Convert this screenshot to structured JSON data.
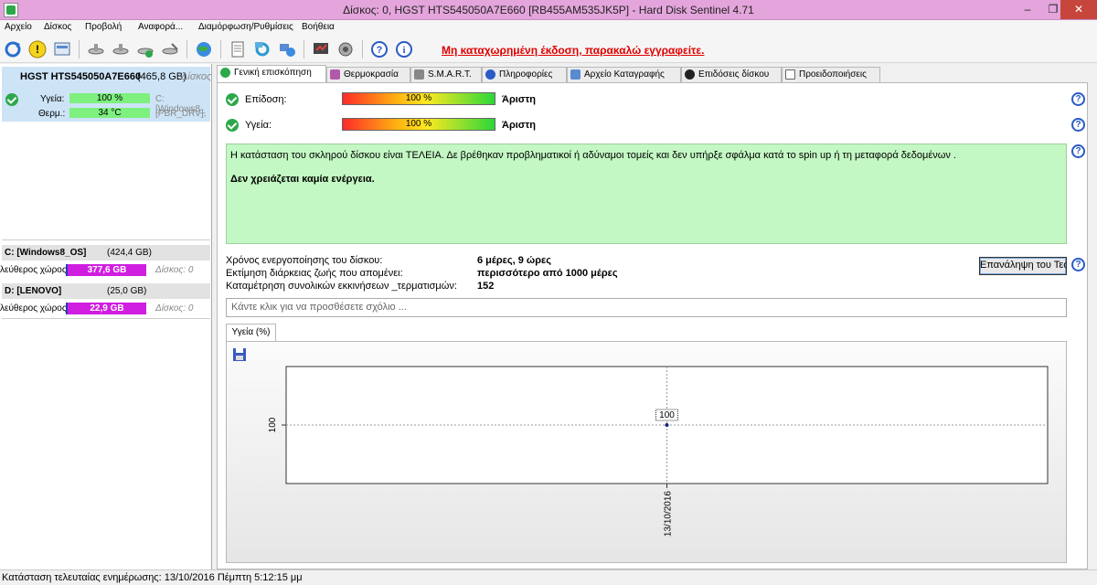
{
  "window": {
    "title": "Δίσκος: 0, HGST HTS545050A7E660 [RB455AM535JK5P]  -  Hard Disk Sentinel 4.71",
    "min": "–",
    "max": "❐",
    "close": "✕"
  },
  "menu": [
    "Αρχείο",
    "Δίσκος",
    "Προβολή",
    "Αναφορά...",
    "Διαμόρφωση/Ρυθμίσεις",
    "Βοήθεια"
  ],
  "toolbar": {
    "icons": [
      "refresh-icon",
      "warning-icon",
      "disk-report-icon",
      "satellite-icon",
      "satellite-alt-icon",
      "satellite-check-icon",
      "satellite-tools-icon",
      "globe-icon",
      "document-icon",
      "sync-icon",
      "network-icon",
      "test-icon",
      "sound-icon",
      "help-icon",
      "info-icon"
    ],
    "registration_msg": "Μη καταχωρημένη έκδοση, παρακαλώ εγγραφείτε."
  },
  "disk": {
    "name": "HGST HTS545050A7E660",
    "size": "(465,8 GB)",
    "extra": "Δίσκος",
    "health_label": "Υγεία:",
    "health_value": "100 %",
    "health_pct": 100,
    "temp_label": "Θερμ.:",
    "temp_value": "34 °C",
    "partition_1": "C: [Windows8_",
    "partition_2": "[PBR_DRV],"
  },
  "volumes": [
    {
      "name": "C: [Windows8_OS]",
      "size": "(424,4 GB)",
      "free_label": "λεύθερος χώρος",
      "free": "377,6 GB",
      "disk": "Δίσκος: 0"
    },
    {
      "name": "D: [LENOVO]",
      "size": "(25,0 GB)",
      "free_label": "λεύθερος χώρος",
      "free": "22,9 GB",
      "disk": "Δίσκος: 0"
    }
  ],
  "tabs": [
    "Γενική επισκόπηση",
    "Θερμοκρασία",
    "S.M.A.R.T.",
    "Πληροφορίες",
    "Αρχείο Καταγραφής",
    "Επιδόσεις δίσκου",
    "Προειδοποιήσεις"
  ],
  "overview": {
    "performance_label": "Επίδοση:",
    "performance_value": "100 %",
    "performance_rating": "Άριστη",
    "health_label": "Υγεία:",
    "health_value": "100 %",
    "health_rating": "Άριστη",
    "status_text": "Η κατάσταση του σκληρού δίσκου είναι ΤΕΛΕΙΑ. Δε βρέθηκαν προβληματικοί ή αδύναμοι τομείς και δεν υπήρξε σφάλμα κατά το spin up ή τη μεταφορά δεδομένων .",
    "action_text": "Δεν χρειάζεται καμία ενέργεια.",
    "power_on_label": "Χρόνος ενεργοποίησης του δίσκου:",
    "power_on_value": "6 μέρες, 9 ώρες",
    "lifetime_label": "Εκτίμηση διάρκειας ζωής που απομένει:",
    "lifetime_value": "περισσότερο από 1000 μέρες",
    "startstop_label": "Καταμέτρηση συνολικών εκκινήσεων _τερματισμών:",
    "startstop_value": "152",
    "repeat_button": "Επανάληψη του Τεστ",
    "comment_placeholder": "Κάντε κλικ για να προσθέσετε σχόλιο ..."
  },
  "chart_tab": "Υγεία (%)",
  "chart_data": {
    "type": "line",
    "x": [
      "13/10/2016"
    ],
    "series": [
      {
        "values": [
          100
        ]
      }
    ],
    "data_labels": [
      "100"
    ],
    "ytick_labels": [
      "100"
    ],
    "grid": true
  },
  "statusbar": {
    "text": "Κατάσταση τελευταίας ενημέρωσης: 13/10/2016 Πέμπτη 5:12:15 μμ"
  },
  "colors": {
    "titlebar": "#e3a5db",
    "health_bar": "#7df07d",
    "volume_bar": "#d01ee0",
    "status_box": "#c3f7c3",
    "reg_msg": "#e00000"
  }
}
